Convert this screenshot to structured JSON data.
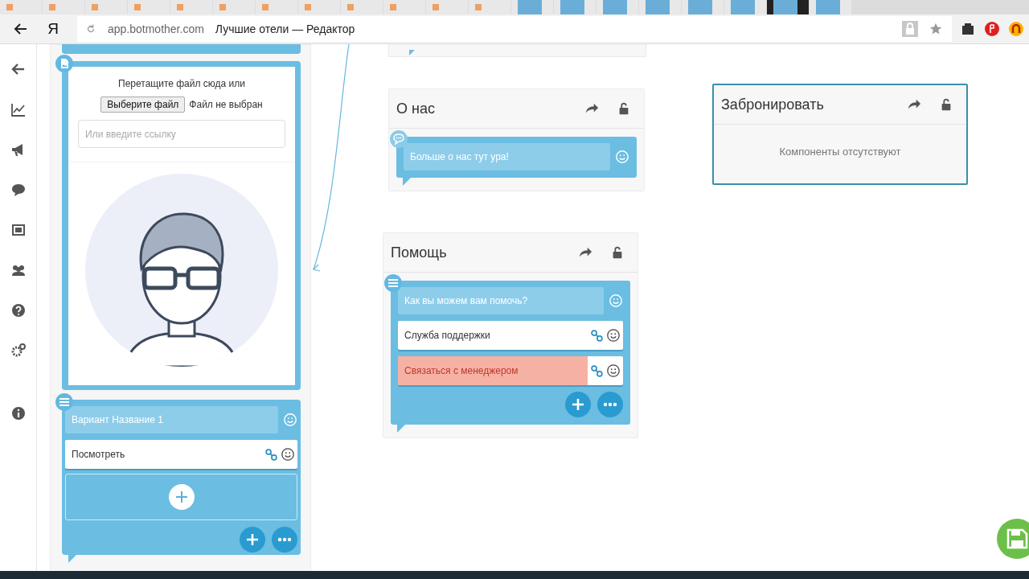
{
  "browser": {
    "tabs": [
      {
        "selected": false
      },
      {
        "selected": false
      },
      {
        "selected": false
      },
      {
        "selected": false
      },
      {
        "selected": false
      },
      {
        "selected": false
      },
      {
        "selected": false
      },
      {
        "selected": false
      },
      {
        "selected": false
      },
      {
        "selected": false
      },
      {
        "selected": false
      },
      {
        "selected": false
      },
      {
        "selected": false
      },
      {
        "selected": false
      },
      {
        "selected": false
      },
      {
        "selected": false
      },
      {
        "selected": false
      },
      {
        "selected": false
      },
      {
        "selected": true
      },
      {
        "selected": false
      }
    ],
    "logo": "Я",
    "url": "app.botmother.com",
    "page_title": "Лучшие отели — Редактор"
  },
  "image_block": {
    "drop_hint": "Перетащите файл сюда или",
    "file_button": "Выберите файл",
    "file_status": "Файл не выбран",
    "link_placeholder": "Или введите ссылку"
  },
  "left_buttons_block": {
    "message": "Вариант Название 1",
    "buttons": [
      {
        "label": "Посмотреть",
        "highlighted": false
      }
    ]
  },
  "cards": [
    {
      "title": "О нас",
      "selected": false,
      "kind": "message",
      "message": "Больше о нас тут ура!"
    },
    {
      "title": "Забронировать",
      "selected": true,
      "kind": "empty",
      "empty_text": "Компоненты отсутствуют"
    },
    {
      "title": "Помощь",
      "selected": false,
      "kind": "buttons",
      "message": "Как вы можем вам помочь?",
      "buttons": [
        {
          "label": "Служба поддержки",
          "highlighted": false
        },
        {
          "label": "Связаться с менеджером",
          "highlighted": true
        }
      ]
    }
  ]
}
